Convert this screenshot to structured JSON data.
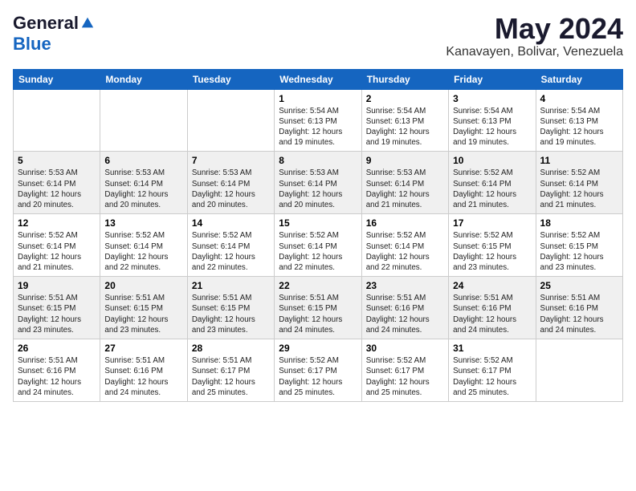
{
  "logo": {
    "general": "General",
    "blue": "Blue",
    "tagline": ""
  },
  "title": "May 2024",
  "location": "Kanavayen, Bolivar, Venezuela",
  "days_of_week": [
    "Sunday",
    "Monday",
    "Tuesday",
    "Wednesday",
    "Thursday",
    "Friday",
    "Saturday"
  ],
  "weeks": [
    [
      {
        "day": "",
        "info": ""
      },
      {
        "day": "",
        "info": ""
      },
      {
        "day": "",
        "info": ""
      },
      {
        "day": "1",
        "info": "Sunrise: 5:54 AM\nSunset: 6:13 PM\nDaylight: 12 hours\nand 19 minutes."
      },
      {
        "day": "2",
        "info": "Sunrise: 5:54 AM\nSunset: 6:13 PM\nDaylight: 12 hours\nand 19 minutes."
      },
      {
        "day": "3",
        "info": "Sunrise: 5:54 AM\nSunset: 6:13 PM\nDaylight: 12 hours\nand 19 minutes."
      },
      {
        "day": "4",
        "info": "Sunrise: 5:54 AM\nSunset: 6:13 PM\nDaylight: 12 hours\nand 19 minutes."
      }
    ],
    [
      {
        "day": "5",
        "info": "Sunrise: 5:53 AM\nSunset: 6:14 PM\nDaylight: 12 hours\nand 20 minutes."
      },
      {
        "day": "6",
        "info": "Sunrise: 5:53 AM\nSunset: 6:14 PM\nDaylight: 12 hours\nand 20 minutes."
      },
      {
        "day": "7",
        "info": "Sunrise: 5:53 AM\nSunset: 6:14 PM\nDaylight: 12 hours\nand 20 minutes."
      },
      {
        "day": "8",
        "info": "Sunrise: 5:53 AM\nSunset: 6:14 PM\nDaylight: 12 hours\nand 20 minutes."
      },
      {
        "day": "9",
        "info": "Sunrise: 5:53 AM\nSunset: 6:14 PM\nDaylight: 12 hours\nand 21 minutes."
      },
      {
        "day": "10",
        "info": "Sunrise: 5:52 AM\nSunset: 6:14 PM\nDaylight: 12 hours\nand 21 minutes."
      },
      {
        "day": "11",
        "info": "Sunrise: 5:52 AM\nSunset: 6:14 PM\nDaylight: 12 hours\nand 21 minutes."
      }
    ],
    [
      {
        "day": "12",
        "info": "Sunrise: 5:52 AM\nSunset: 6:14 PM\nDaylight: 12 hours\nand 21 minutes."
      },
      {
        "day": "13",
        "info": "Sunrise: 5:52 AM\nSunset: 6:14 PM\nDaylight: 12 hours\nand 22 minutes."
      },
      {
        "day": "14",
        "info": "Sunrise: 5:52 AM\nSunset: 6:14 PM\nDaylight: 12 hours\nand 22 minutes."
      },
      {
        "day": "15",
        "info": "Sunrise: 5:52 AM\nSunset: 6:14 PM\nDaylight: 12 hours\nand 22 minutes."
      },
      {
        "day": "16",
        "info": "Sunrise: 5:52 AM\nSunset: 6:14 PM\nDaylight: 12 hours\nand 22 minutes."
      },
      {
        "day": "17",
        "info": "Sunrise: 5:52 AM\nSunset: 6:15 PM\nDaylight: 12 hours\nand 23 minutes."
      },
      {
        "day": "18",
        "info": "Sunrise: 5:52 AM\nSunset: 6:15 PM\nDaylight: 12 hours\nand 23 minutes."
      }
    ],
    [
      {
        "day": "19",
        "info": "Sunrise: 5:51 AM\nSunset: 6:15 PM\nDaylight: 12 hours\nand 23 minutes."
      },
      {
        "day": "20",
        "info": "Sunrise: 5:51 AM\nSunset: 6:15 PM\nDaylight: 12 hours\nand 23 minutes."
      },
      {
        "day": "21",
        "info": "Sunrise: 5:51 AM\nSunset: 6:15 PM\nDaylight: 12 hours\nand 23 minutes."
      },
      {
        "day": "22",
        "info": "Sunrise: 5:51 AM\nSunset: 6:15 PM\nDaylight: 12 hours\nand 24 minutes."
      },
      {
        "day": "23",
        "info": "Sunrise: 5:51 AM\nSunset: 6:16 PM\nDaylight: 12 hours\nand 24 minutes."
      },
      {
        "day": "24",
        "info": "Sunrise: 5:51 AM\nSunset: 6:16 PM\nDaylight: 12 hours\nand 24 minutes."
      },
      {
        "day": "25",
        "info": "Sunrise: 5:51 AM\nSunset: 6:16 PM\nDaylight: 12 hours\nand 24 minutes."
      }
    ],
    [
      {
        "day": "26",
        "info": "Sunrise: 5:51 AM\nSunset: 6:16 PM\nDaylight: 12 hours\nand 24 minutes."
      },
      {
        "day": "27",
        "info": "Sunrise: 5:51 AM\nSunset: 6:16 PM\nDaylight: 12 hours\nand 24 minutes."
      },
      {
        "day": "28",
        "info": "Sunrise: 5:51 AM\nSunset: 6:17 PM\nDaylight: 12 hours\nand 25 minutes."
      },
      {
        "day": "29",
        "info": "Sunrise: 5:52 AM\nSunset: 6:17 PM\nDaylight: 12 hours\nand 25 minutes."
      },
      {
        "day": "30",
        "info": "Sunrise: 5:52 AM\nSunset: 6:17 PM\nDaylight: 12 hours\nand 25 minutes."
      },
      {
        "day": "31",
        "info": "Sunrise: 5:52 AM\nSunset: 6:17 PM\nDaylight: 12 hours\nand 25 minutes."
      },
      {
        "day": "",
        "info": ""
      }
    ]
  ]
}
